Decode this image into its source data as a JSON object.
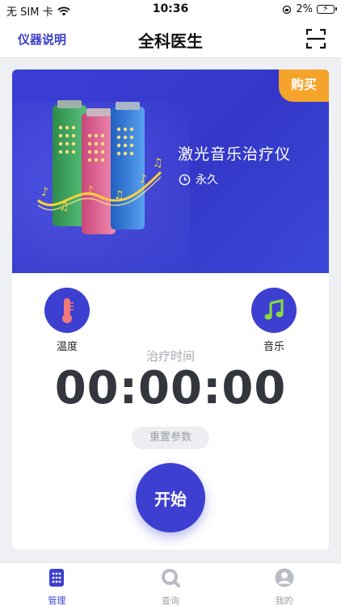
{
  "status_bar": {
    "carrier": "无 SIM 卡",
    "time": "10:36",
    "battery": "2%"
  },
  "nav": {
    "left_label": "仪器说明",
    "title": "全科医生",
    "scan_icon": "scan-icon"
  },
  "banner": {
    "buy_label": "购买",
    "product_name": "激光音乐治疗仪",
    "duration": "永久"
  },
  "controls": {
    "temperature_label": "温度",
    "music_label": "音乐",
    "time_label": "治疗时间",
    "timer_value": "00:00:00",
    "reset_label": "重置参数",
    "start_label": "开始"
  },
  "tabs": [
    {
      "label": "管理",
      "icon": "grid-icon",
      "active": true
    },
    {
      "label": "查询",
      "icon": "search-icon",
      "active": false
    },
    {
      "label": "我的",
      "icon": "user-icon",
      "active": false
    }
  ],
  "colors": {
    "accent": "#3d3fd1",
    "banner": "#3b3fd6",
    "buy_badge": "#f5a32a",
    "thermometer": "#f07a7a",
    "music_note": "#8bdc3a"
  }
}
